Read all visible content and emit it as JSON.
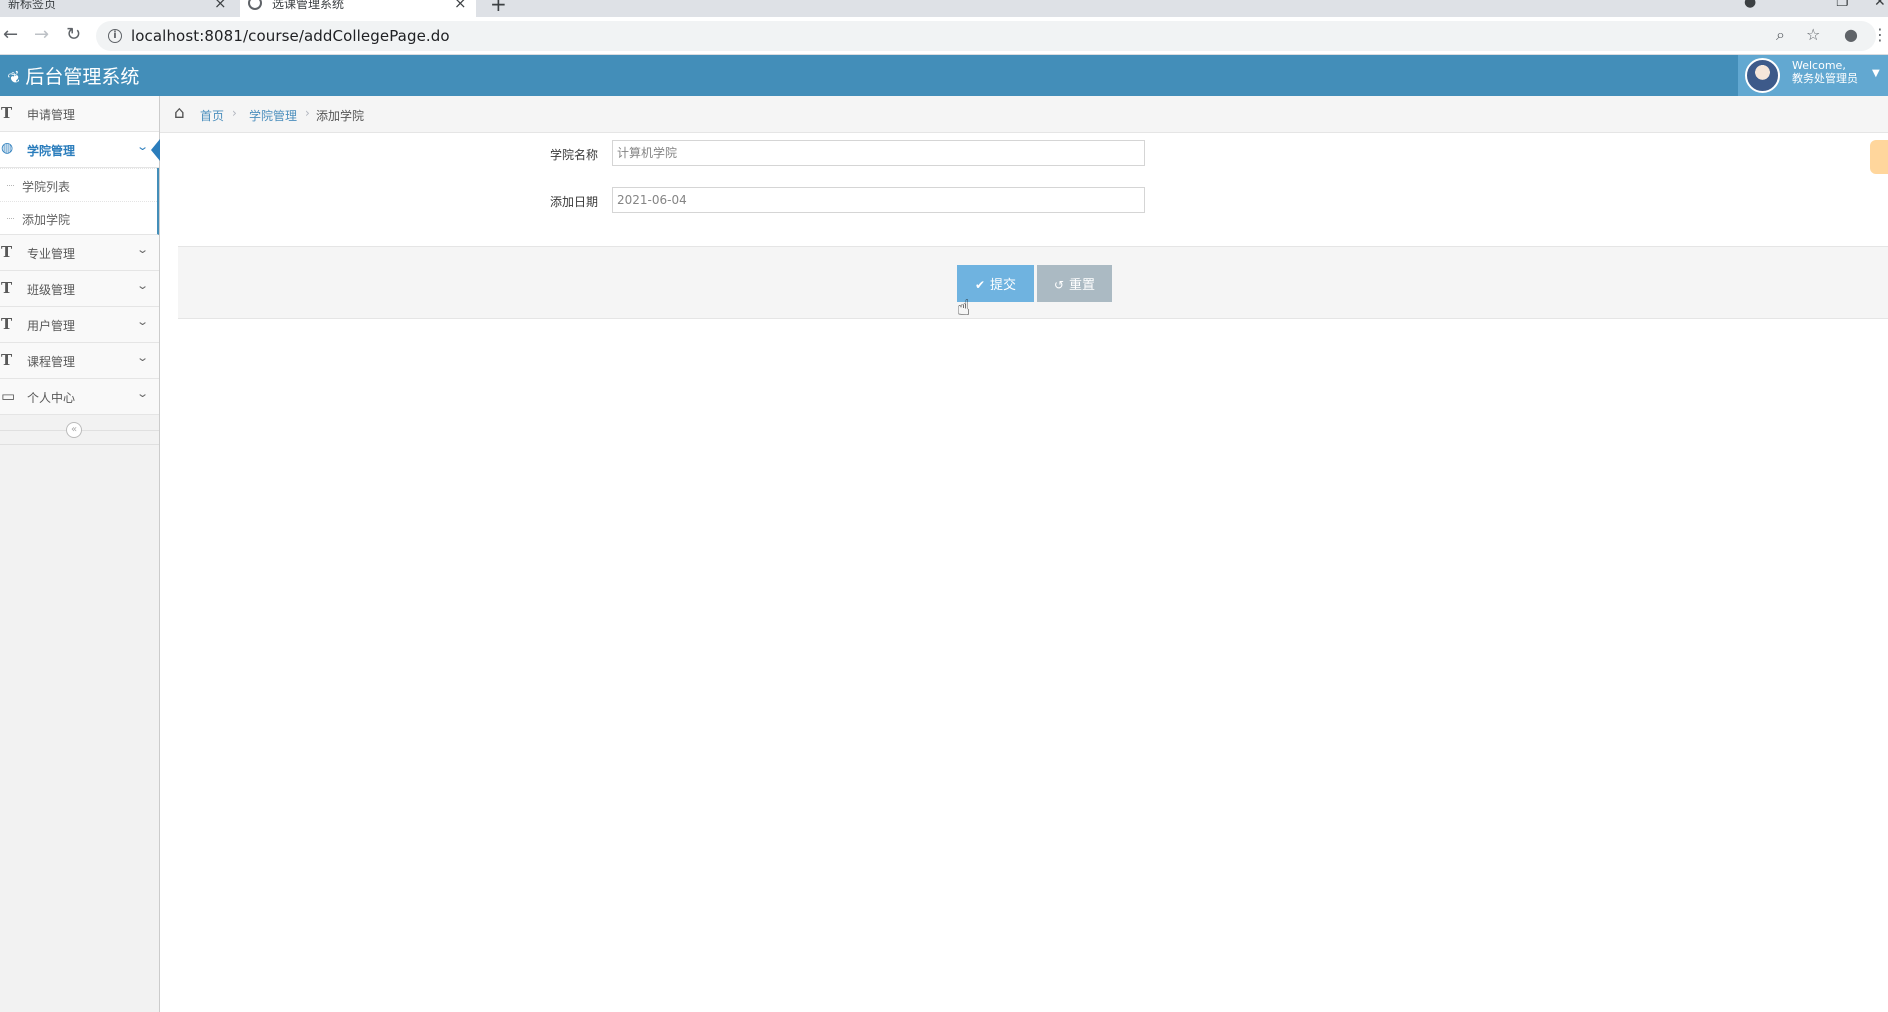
{
  "browser": {
    "tabs": [
      {
        "title": "新标签页",
        "active": false
      },
      {
        "title": "选课管理系统",
        "active": true
      }
    ],
    "url": "localhost:8081/course/addCollegePage.do"
  },
  "header": {
    "brand": "后台管理系统",
    "welcome": "Welcome,",
    "user": "教务处管理员"
  },
  "sidebar": {
    "items": [
      {
        "label": "申请管理",
        "icon": "text-icon",
        "active": false
      },
      {
        "label": "学院管理",
        "icon": "dashboard-icon",
        "active": true,
        "children": [
          {
            "label": "学院列表"
          },
          {
            "label": "添加学院"
          }
        ]
      },
      {
        "label": "专业管理",
        "icon": "text-icon",
        "active": false
      },
      {
        "label": "班级管理",
        "icon": "text-icon",
        "active": false
      },
      {
        "label": "用户管理",
        "icon": "text-icon",
        "active": false
      },
      {
        "label": "课程管理",
        "icon": "text-icon",
        "active": false
      },
      {
        "label": "个人中心",
        "icon": "desktop-icon",
        "active": false
      }
    ]
  },
  "breadcrumb": {
    "home": "首页",
    "section": "学院管理",
    "current": "添加学院"
  },
  "form": {
    "college_name": {
      "label": "学院名称",
      "placeholder": "计算机学院",
      "value": ""
    },
    "add_date": {
      "label": "添加日期",
      "value": "2021-06-04"
    },
    "submit_label": "提交",
    "reset_label": "重置"
  },
  "colors": {
    "header": "#438eb9",
    "user_box": "#62a8d1",
    "submit": "#6fb3e0",
    "reset": "#abbac3",
    "active_menu": "#2b7dbc"
  }
}
